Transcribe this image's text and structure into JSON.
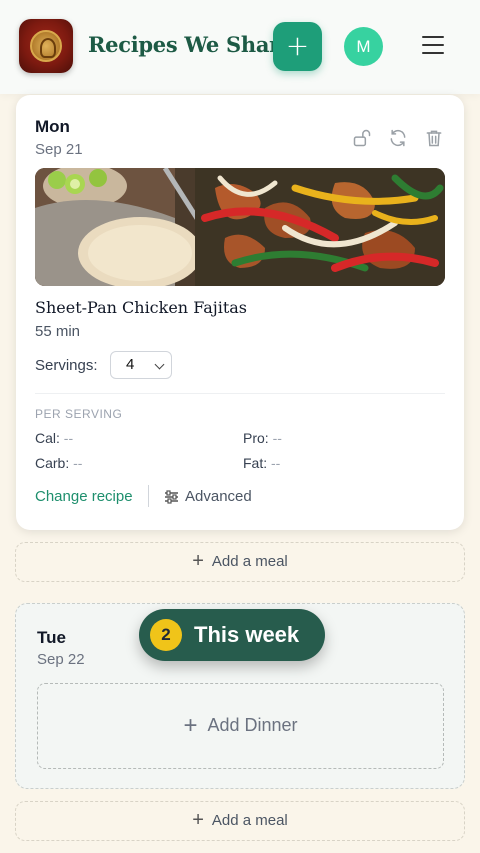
{
  "header": {
    "app_title": "Recipes We Share",
    "add_label": "+",
    "avatar_initial": "M",
    "accent_color": "#1e9e79",
    "title_color": "#1d5a45"
  },
  "days": [
    {
      "name": "Mon",
      "date": "Sep 21",
      "recipe": {
        "name": "Sheet-Pan Chicken Fajitas",
        "time": "55 min"
      },
      "servings_label": "Servings:",
      "servings_value": "4",
      "per_serving_label": "PER SERVING",
      "nutrition": {
        "cal_label": "Cal:",
        "cal_value": "--",
        "pro_label": "Pro:",
        "pro_value": "--",
        "carb_label": "Carb:",
        "carb_value": "--",
        "fat_label": "Fat:",
        "fat_value": "--"
      },
      "change_recipe": "Change recipe",
      "advanced": "Advanced",
      "add_meal": "Add a meal"
    },
    {
      "name": "Tue",
      "date": "Sep 22",
      "add_dinner": "Add Dinner",
      "add_meal": "Add a meal"
    }
  ],
  "week_pill": {
    "badge": "2",
    "label": "This week"
  }
}
